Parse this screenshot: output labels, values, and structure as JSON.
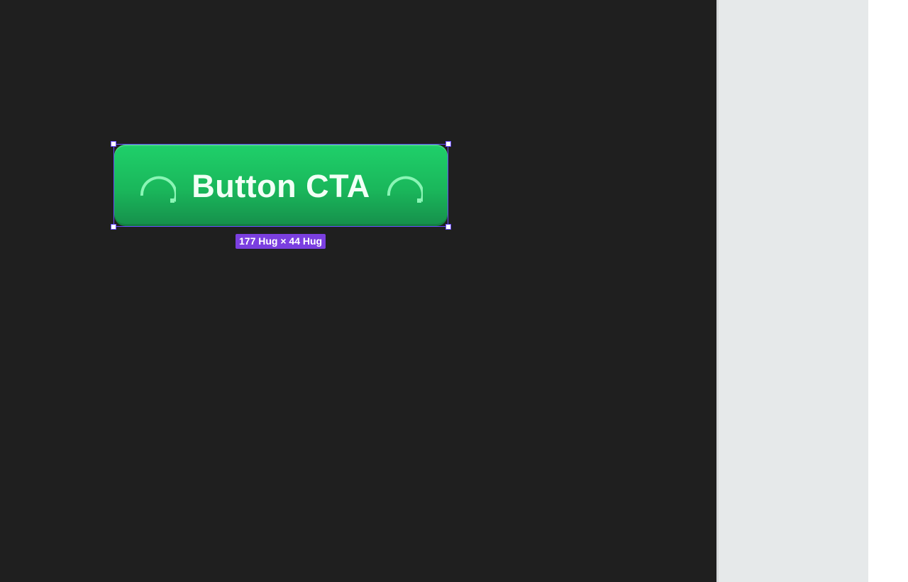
{
  "canvas": {
    "background_color": "#1f1f1f"
  },
  "right_panel": {
    "background_color": "#e6e9ea"
  },
  "selected_button": {
    "label": "Button CTA",
    "fill_color": "#1fd06a",
    "text_color": "#f2fff6",
    "leading_icon": "loading-spinner-icon",
    "trailing_icon": "loading-spinner-icon"
  },
  "selection": {
    "outline_color": "#6a4cff",
    "size_label": "177 Hug × 44 Hug",
    "badge_color": "#7b3fe0"
  }
}
